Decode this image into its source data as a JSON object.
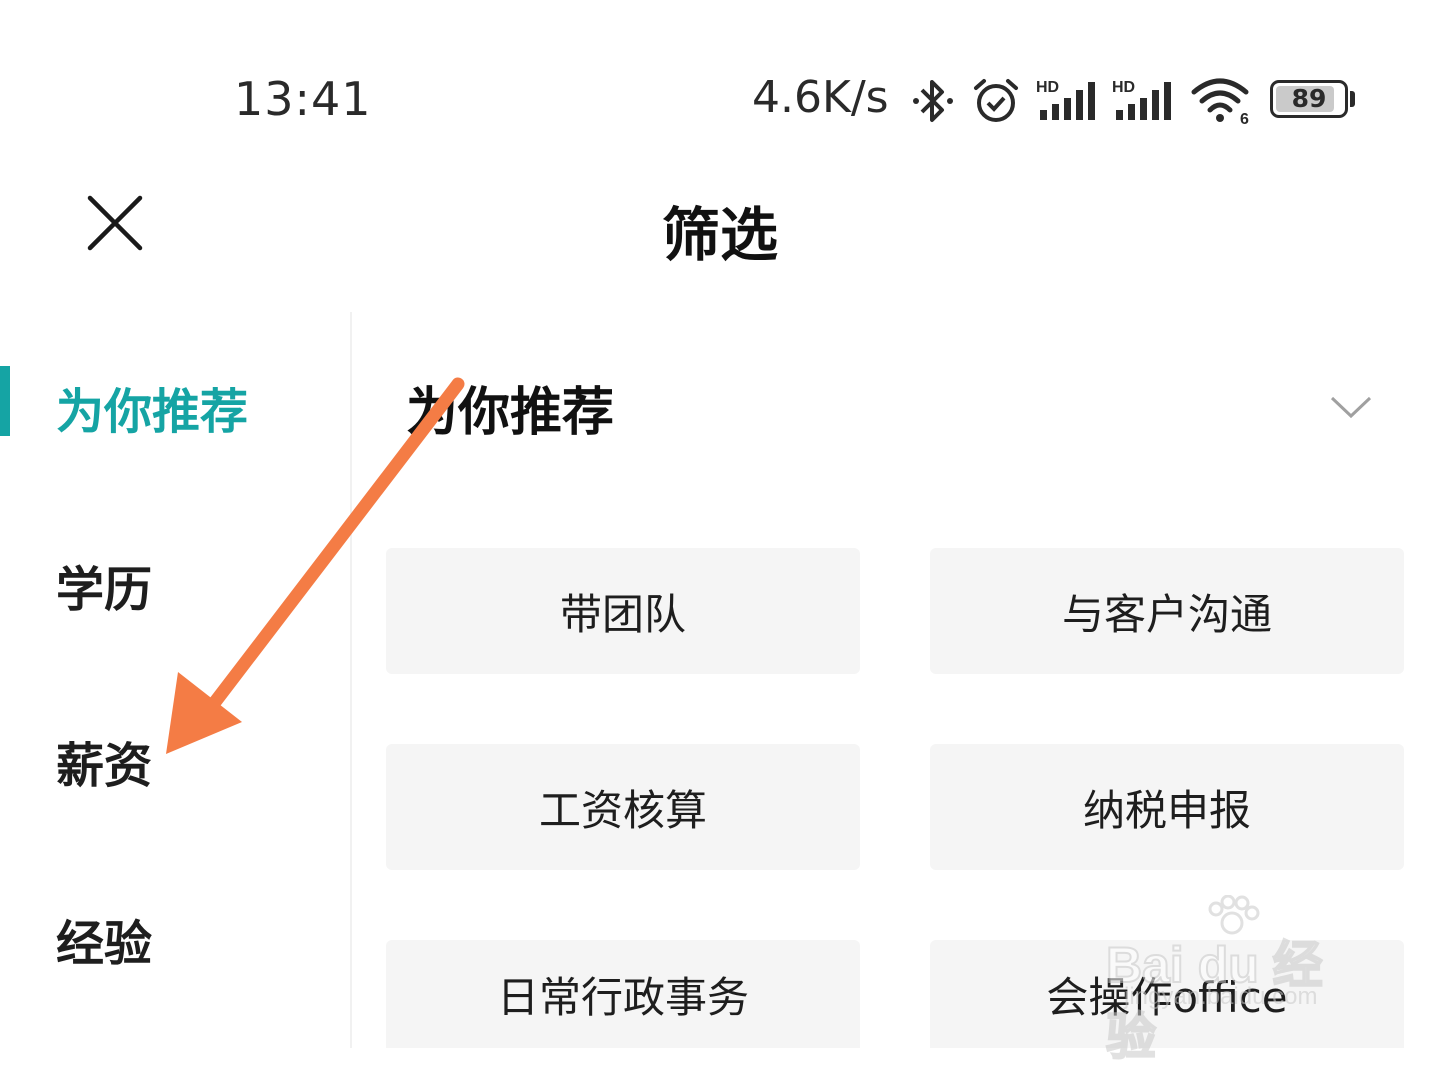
{
  "status_bar": {
    "time": "13:41",
    "net_speed": "4.6K/s",
    "battery": "89",
    "icons": [
      "bluetooth-icon",
      "alarm-icon",
      "signal-hd-icon",
      "signal-hd-icon",
      "wifi-6-icon",
      "battery-icon"
    ]
  },
  "header": {
    "title": "筛选",
    "close_icon": "close-icon"
  },
  "sidebar": {
    "items": [
      {
        "label": "为你推荐",
        "active": true
      },
      {
        "label": "学历",
        "active": false
      },
      {
        "label": "薪资",
        "active": false
      },
      {
        "label": "经验",
        "active": false
      }
    ]
  },
  "main": {
    "section_title": "为你推荐",
    "expand_icon": "chevron-down-icon",
    "tags": [
      "带团队",
      "与客户沟通",
      "工资核算",
      "纳税申报",
      "日常行政事务",
      "会操作office"
    ]
  },
  "colors": {
    "accent": "#15a4a4",
    "annotation_arrow": "#f47c45",
    "tag_bg": "#f5f5f5"
  },
  "watermark": {
    "main": "Bai du 经验",
    "sub": "jingyan.baidu.com"
  }
}
